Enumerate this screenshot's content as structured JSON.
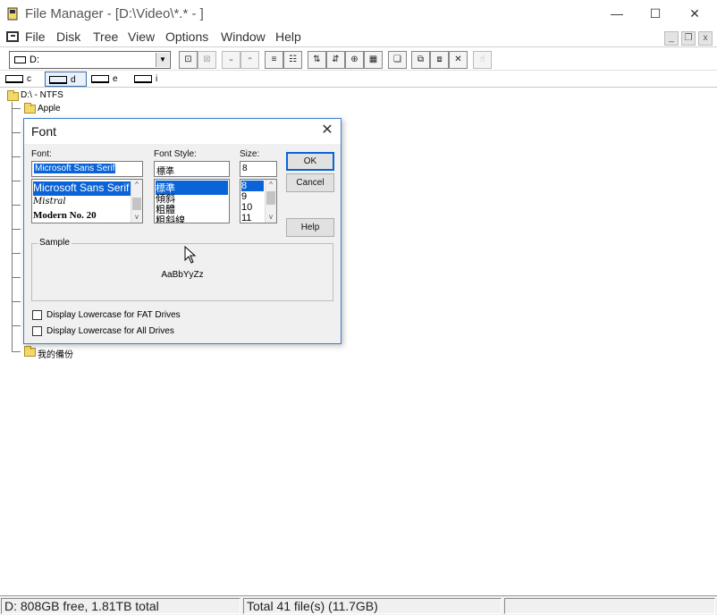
{
  "window": {
    "title": "File Manager - [D:\\Video\\*.* - ]",
    "minimize": "—",
    "maximize": "☐",
    "close": "✕"
  },
  "menu": {
    "items": [
      "File",
      "Disk",
      "Tree",
      "View",
      "Options",
      "Window",
      "Help"
    ],
    "mdi_minimize": "_",
    "mdi_restore": "❐",
    "mdi_close": "x"
  },
  "toolbar": {
    "drive_select_value": "D:",
    "dropdown_arrow": "▼",
    "buttons": [
      {
        "name": "connect-net-drive",
        "glyph": "⊡"
      },
      {
        "name": "disconnect-net-drive",
        "glyph": "⊠"
      },
      {
        "name": "share-as",
        "glyph": "◒"
      },
      {
        "name": "stop-sharing",
        "glyph": "◓"
      },
      {
        "name": "view-name",
        "glyph": "≡"
      },
      {
        "name": "view-details",
        "glyph": "☷"
      },
      {
        "name": "sort-name",
        "glyph": "⇅"
      },
      {
        "name": "sort-type",
        "glyph": "⇵"
      },
      {
        "name": "sort-size",
        "glyph": "⊕"
      },
      {
        "name": "sort-date",
        "glyph": "▦"
      },
      {
        "name": "new-window",
        "glyph": "❏"
      },
      {
        "name": "copy",
        "glyph": "⧉"
      },
      {
        "name": "move",
        "glyph": "⧈"
      },
      {
        "name": "delete",
        "glyph": "✕"
      },
      {
        "name": "help",
        "glyph": "☝"
      }
    ]
  },
  "drives": [
    {
      "letter": "c",
      "selected": false
    },
    {
      "letter": "d",
      "selected": true
    },
    {
      "letter": "e",
      "selected": false
    },
    {
      "letter": "i",
      "selected": false
    }
  ],
  "tree": {
    "root": "D:\\ - NTFS",
    "first_folder": "Apple",
    "last_folder": "我的備份"
  },
  "status": {
    "left": "D: 808GB free,  1.81TB total",
    "right": "Total 41 file(s) (11.7GB)"
  },
  "font_dialog": {
    "title": "Font",
    "close": "✕",
    "font_label": "Font:",
    "font_value": "Microsoft Sans Serif",
    "font_list": [
      "Microsoft Sans Serif",
      "Mistral",
      "Modern No. 20"
    ],
    "style_label": "Font Style:",
    "style_value": "標準",
    "style_list": [
      "標準",
      "傾斜",
      "粗體",
      "粗斜線"
    ],
    "size_label": "Size:",
    "size_value": "8",
    "size_list": [
      "8",
      "9",
      "10",
      "11"
    ],
    "ok_label": "OK",
    "cancel_label": "Cancel",
    "help_label": "Help",
    "sample_label": "Sample",
    "sample_text": "AaBbYyZz",
    "chk_fat_label": "Display Lowercase for FAT Drives",
    "chk_all_label": "Display Lowercase for All Drives",
    "scroll_up": "^",
    "scroll_down": "v"
  }
}
